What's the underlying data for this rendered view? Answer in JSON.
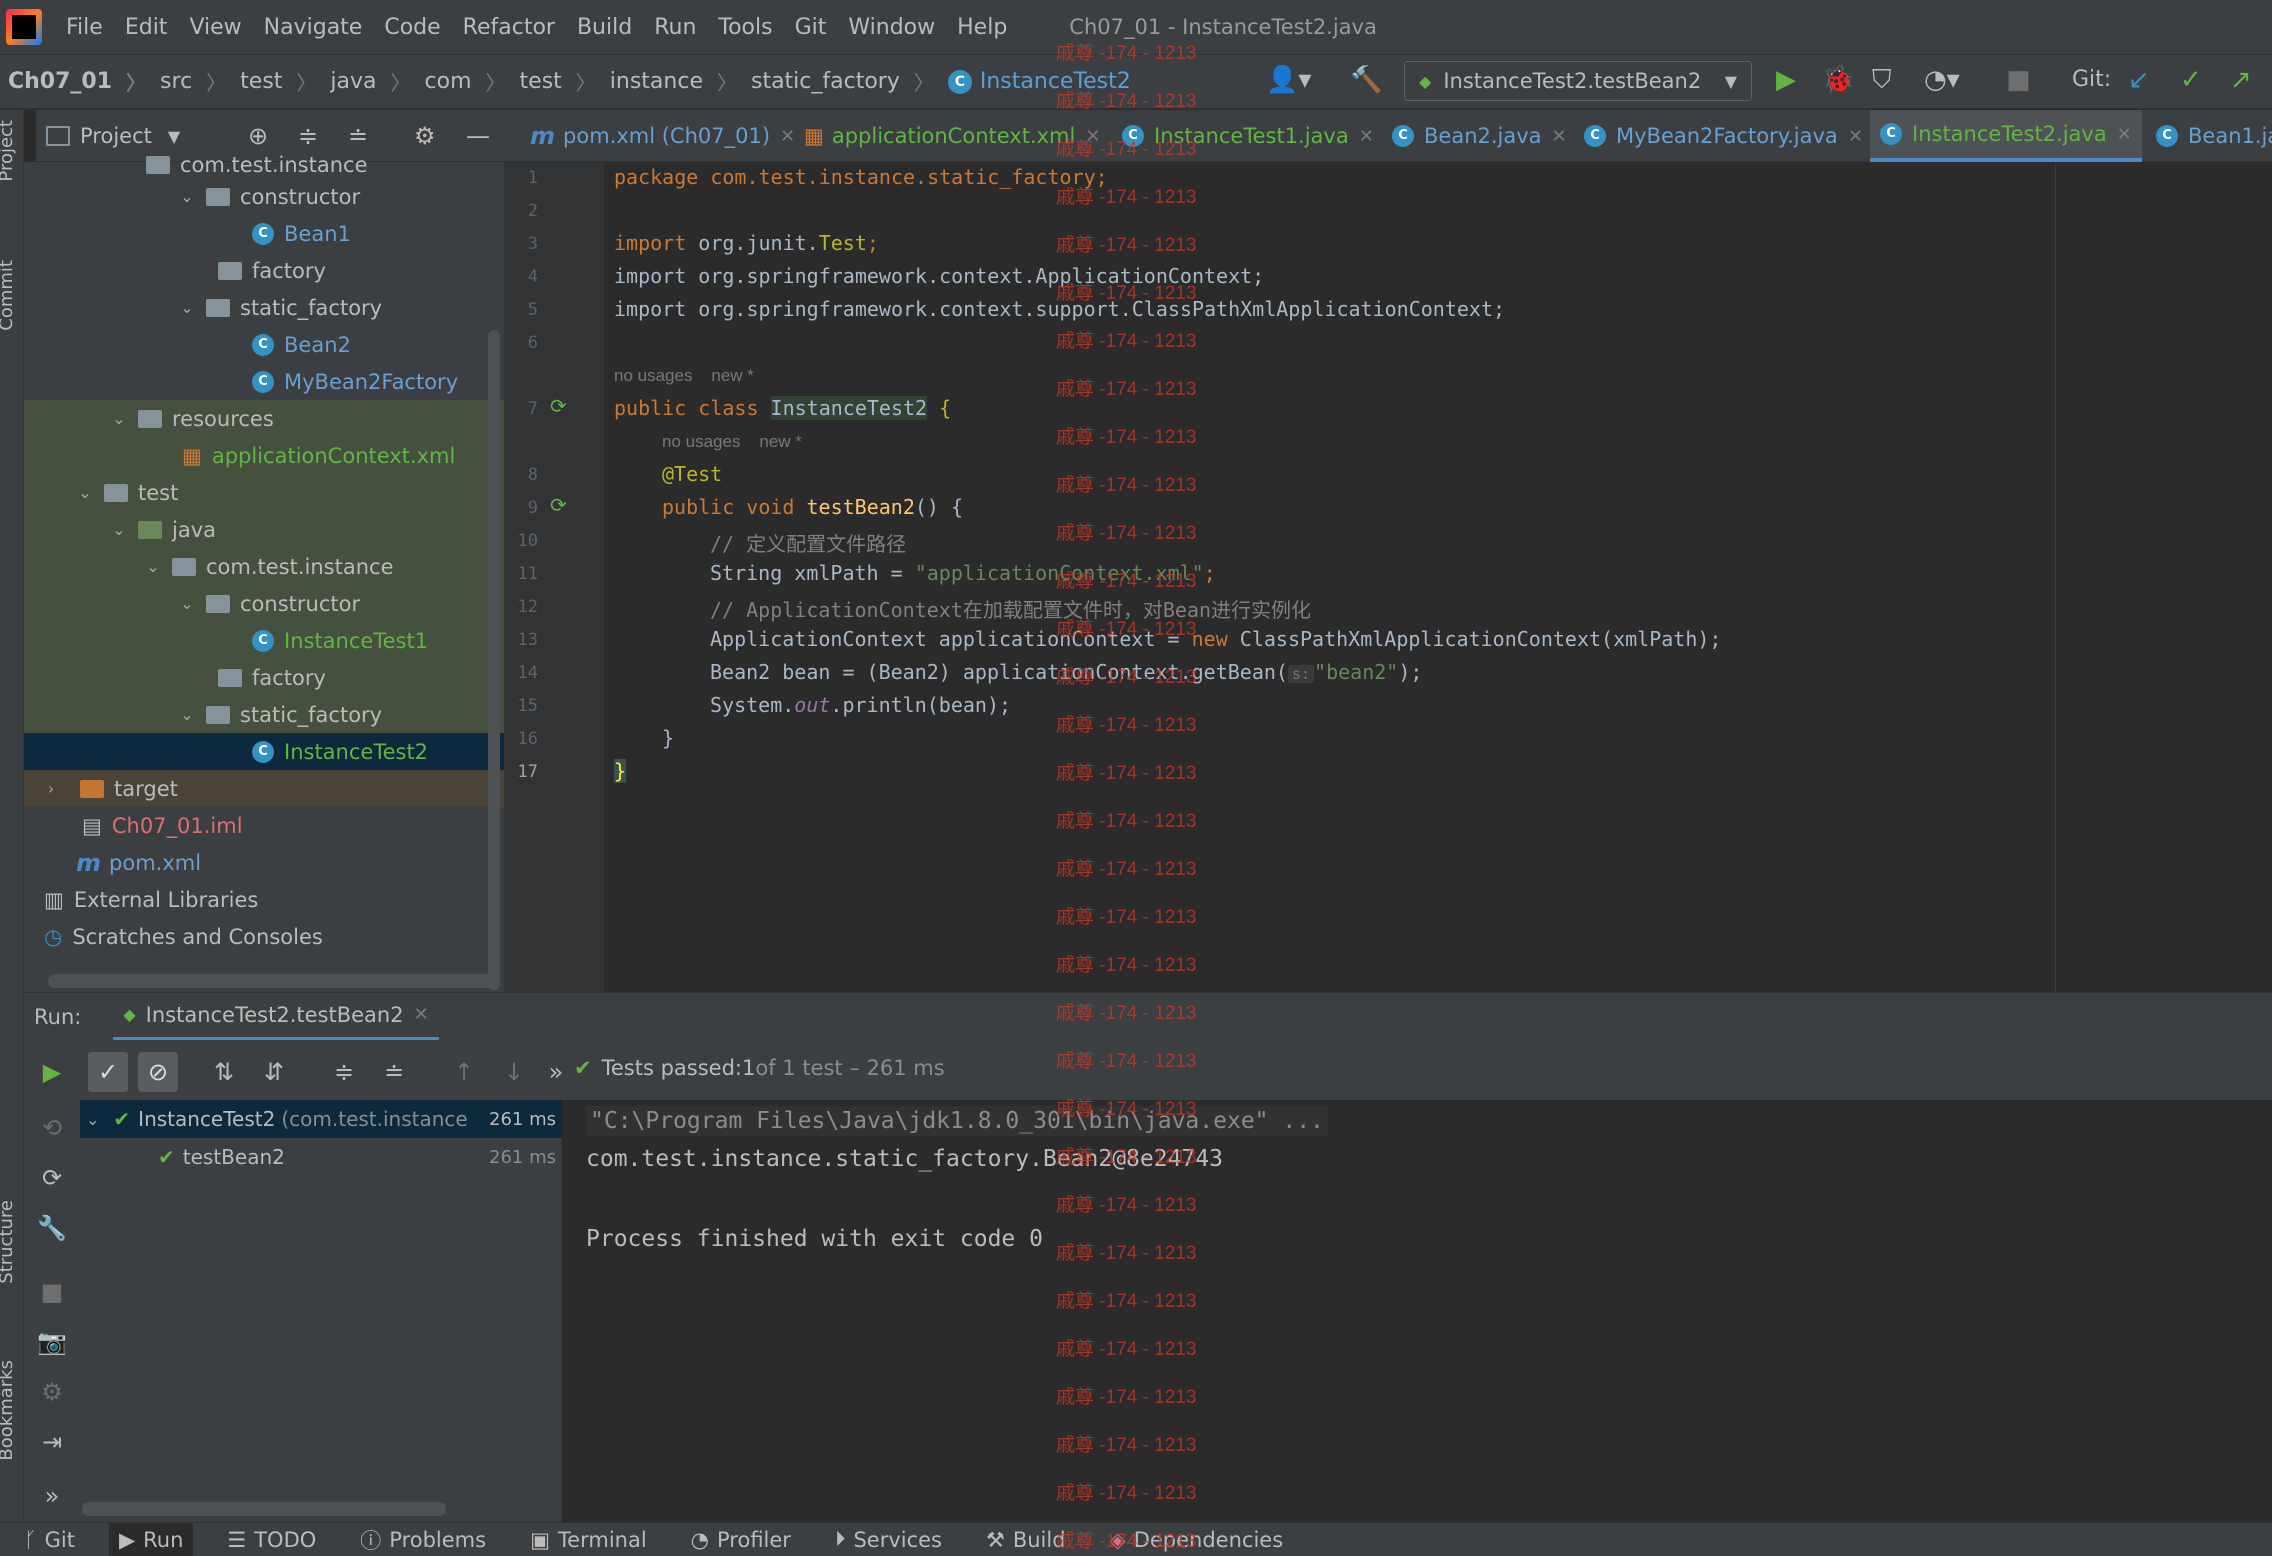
{
  "menu": {
    "items": [
      "File",
      "Edit",
      "View",
      "Navigate",
      "Code",
      "Refactor",
      "Build",
      "Run",
      "Tools",
      "Git",
      "Window",
      "Help"
    ],
    "window_title": "Ch07_01 - InstanceTest2.java"
  },
  "breadcrumb": [
    "Ch07_01",
    "src",
    "test",
    "java",
    "com",
    "test",
    "instance",
    "static_factory",
    "InstanceTest2"
  ],
  "run_config": "InstanceTest2.testBean2",
  "git_label": "Git:",
  "project_tool": {
    "label": "Project"
  },
  "tabs": [
    {
      "label": "pom.xml (Ch07_01)",
      "icon": "maven-icon"
    },
    {
      "label": "applicationContext.xml",
      "icon": "xml-icon"
    },
    {
      "label": "InstanceTest1.java",
      "icon": "class-icon"
    },
    {
      "label": "Bean2.java",
      "icon": "class-icon"
    },
    {
      "label": "MyBean2Factory.java",
      "icon": "class-icon"
    },
    {
      "label": "InstanceTest2.java",
      "icon": "class-icon"
    },
    {
      "label": "Bean1.ja",
      "icon": "class-icon"
    }
  ],
  "tree": [
    {
      "label": "com.test.instance"
    },
    {
      "label": "constructor"
    },
    {
      "label": "Bean1"
    },
    {
      "label": "factory"
    },
    {
      "label": "static_factory"
    },
    {
      "label": "Bean2"
    },
    {
      "label": "MyBean2Factory"
    },
    {
      "label": "resources"
    },
    {
      "label": "applicationContext.xml"
    },
    {
      "label": "test"
    },
    {
      "label": "java"
    },
    {
      "label": "com.test.instance"
    },
    {
      "label": "constructor"
    },
    {
      "label": "InstanceTest1"
    },
    {
      "label": "factory"
    },
    {
      "label": "static_factory"
    },
    {
      "label": "InstanceTest2"
    },
    {
      "label": "target"
    },
    {
      "label": "Ch07_01.iml"
    },
    {
      "label": "pom.xml"
    },
    {
      "label": "External Libraries"
    },
    {
      "label": "Scratches and Consoles"
    }
  ],
  "side_labels": {
    "project": "Project",
    "commit": "Commit",
    "structure": "Structure",
    "bookmarks": "Bookmarks"
  },
  "editor": {
    "line_numbers": [
      "1",
      "2",
      "3",
      "4",
      "5",
      "6",
      "7",
      "8",
      "9",
      "10",
      "11",
      "12",
      "13",
      "14",
      "15",
      "16",
      "17"
    ],
    "hint_no_usages": "no usages",
    "hint_new": "new *",
    "line1": "package com.test.instance.static_factory;",
    "line3_kw": "import",
    "line3_rest": " org.junit.",
    "line3_cls": "Test",
    "line4": "import org.springframework.context.ApplicationContext;",
    "line5": "import org.springframework.context.support.ClassPathXmlApplicationContext;",
    "line7_kw": "public class ",
    "line7_cls": "InstanceTest2",
    "line7_brace": " {",
    "line8_ann": "@Test",
    "line9_kw": "public void ",
    "line9_fn": "testBean2",
    "line9_rest": "() {",
    "line10": "// 定义配置文件路径",
    "line11_a": "String xmlPath = ",
    "line11_str": "\"applicationContext.xml\"",
    "line11_end": ";",
    "line12": "// ApplicationContext在加载配置文件时，对Bean进行实例化",
    "line13_a": "ApplicationContext applicationContext = ",
    "line13_kw": "new",
    "line13_b": " ClassPathXmlApplicationContext(xmlPath);",
    "line14_a": "Bean2 bean = (Bean2) applicationContext.getBean(",
    "line14_hint": "s:",
    "line14_str": "\"bean2\"",
    "line14_end": ");",
    "line15_a": "System.",
    "line15_fld": "out",
    "line15_b": ".println(bean);",
    "line16": "}",
    "line17": "}"
  },
  "run": {
    "label": "Run:",
    "tab": "InstanceTest2.testBean2",
    "status_prefix": "Tests passed: ",
    "status_count": "1",
    "status_rest": " of 1 test – 261 ms",
    "tree_root": "InstanceTest2",
    "tree_root_pkg": "(com.test.instance",
    "tree_root_time": "261 ms",
    "tree_child": "testBean2",
    "tree_child_time": "261 ms",
    "console": [
      "\"C:\\Program Files\\Java\\jdk1.8.0_301\\bin\\java.exe\" ...",
      "com.test.instance.static_factory.Bean2@8e24743",
      "",
      "Process finished with exit code 0"
    ]
  },
  "bottom_tabs": [
    "Git",
    "Run",
    "TODO",
    "Problems",
    "Terminal",
    "Profiler",
    "Services",
    "Build",
    "Dependencies"
  ],
  "watermark": "戚尊 -174 - 1213",
  "colors": {
    "accent": "#4a88c7",
    "pass_green": "#62b543",
    "keyword": "#cc7832",
    "string": "#6a8759"
  }
}
